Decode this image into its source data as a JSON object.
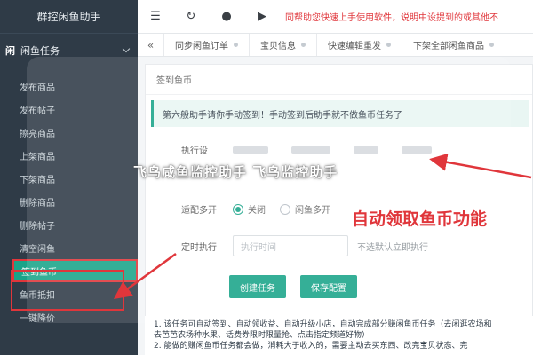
{
  "sidebar": {
    "brand": "群控闲鱼助手",
    "group_icon": "闲",
    "group_label": "闲鱼任务",
    "items": [
      {
        "label": "发布商品"
      },
      {
        "label": "发布帖子"
      },
      {
        "label": "擦亮商品"
      },
      {
        "label": "上架商品"
      },
      {
        "label": "下架商品"
      },
      {
        "label": "删除商品"
      },
      {
        "label": "删除帖子"
      },
      {
        "label": "清空闲鱼"
      },
      {
        "label": "签到鱼币"
      },
      {
        "label": "鱼币抵扣"
      },
      {
        "label": "一键降价"
      }
    ],
    "active_index": 8
  },
  "toolbar": {
    "icons": [
      "menu-icon",
      "refresh-icon",
      "record-icon",
      "play-icon"
    ],
    "menu_glyph": "☰",
    "refresh_glyph": "↻",
    "record_glyph": "●",
    "play_glyph": "▶",
    "notice": "同帮助您快速上手使用软件，说明中设提到的或其他不"
  },
  "tabs": {
    "back_glyph": "«",
    "items": [
      {
        "label": "同步闲鱼订单"
      },
      {
        "label": "宝贝信息"
      },
      {
        "label": "快速编辑重发"
      },
      {
        "label": "下架全部闲鱼商品"
      }
    ]
  },
  "panel": {
    "title": "签到鱼币",
    "alert": "第六般助手请你手动签到！手动签到后助手就不做鱼币任务了",
    "exec_label": "执行设",
    "adapt_label": "适配多开",
    "radio_off": "关闭",
    "radio_on_label": "闲鱼多开",
    "timer_label": "定时执行",
    "timer_placeholder": "执行时间",
    "timer_hint": "不选默认立即执行",
    "create_button": "创建任务",
    "save_button": "保存配置"
  },
  "notes": [
    "1. 该任务可自动签到、自动领收益、自动升级小店，自动完成部分赚闲鱼币任务（去闲逛农场和",
    "去芭芭农场种水果、话费券限时限量抢、点击指定频道好物）",
    "2. 能做的赚闲鱼币任务都会做，消耗大于收入的，需要主动去买东西、改完宝贝状态、完"
  ],
  "overlay": {
    "watermark": "飞鸟咸鱼监控助手 飞鸟监控助手",
    "annotation": "自动领取鱼币功能"
  },
  "colors": {
    "accent": "#1aa489",
    "sidebar_bg": "#2f3b47",
    "highlight_red": "#e0363b"
  }
}
